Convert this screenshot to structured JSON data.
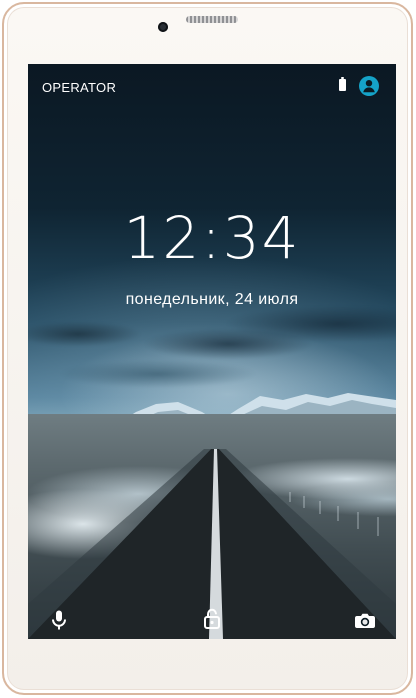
{
  "status_bar": {
    "operator": "OPERATOR",
    "icons": [
      "battery-icon",
      "user-icon"
    ]
  },
  "lock_screen": {
    "time": "12:34",
    "date": "понедельник, 24 июля"
  },
  "bottom_actions": {
    "left_icon": "mic-icon",
    "center_icon": "unlock-icon",
    "right_icon": "camera-icon"
  },
  "colors": {
    "accent": "#15a3c8",
    "text": "#ffffff",
    "device_frame": "#d9b79f"
  }
}
